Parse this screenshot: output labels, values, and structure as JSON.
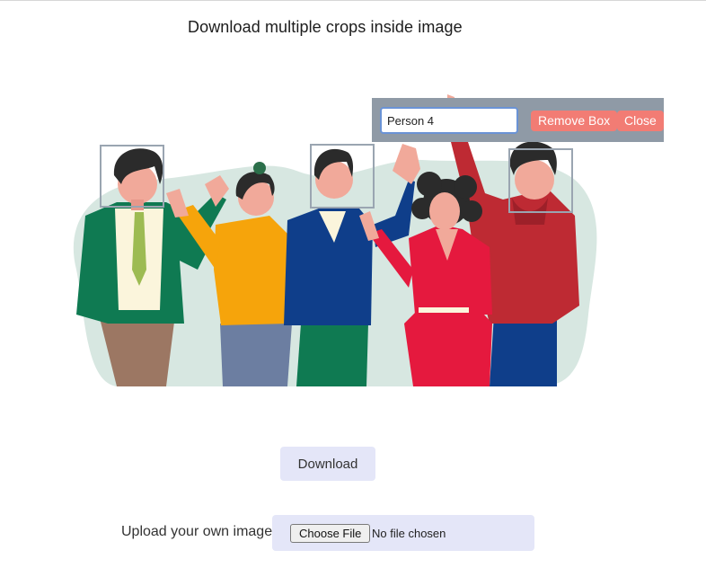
{
  "page": {
    "title": "Download multiple crops inside image"
  },
  "annotation_toolbar": {
    "label_value": "Person 4",
    "remove_label": "Remove Box",
    "close_label": "Close"
  },
  "actions": {
    "download_label": "Download"
  },
  "upload": {
    "label": "Upload your own image",
    "choose_label": "Choose File",
    "status": "No file chosen"
  },
  "colors": {
    "box_border": "#9aa5b1",
    "toolbar_bg": "#8f9aa6",
    "button_red": "#f27c74",
    "panel_bg": "#e4e6f8",
    "blob": "#d7e7e1"
  }
}
